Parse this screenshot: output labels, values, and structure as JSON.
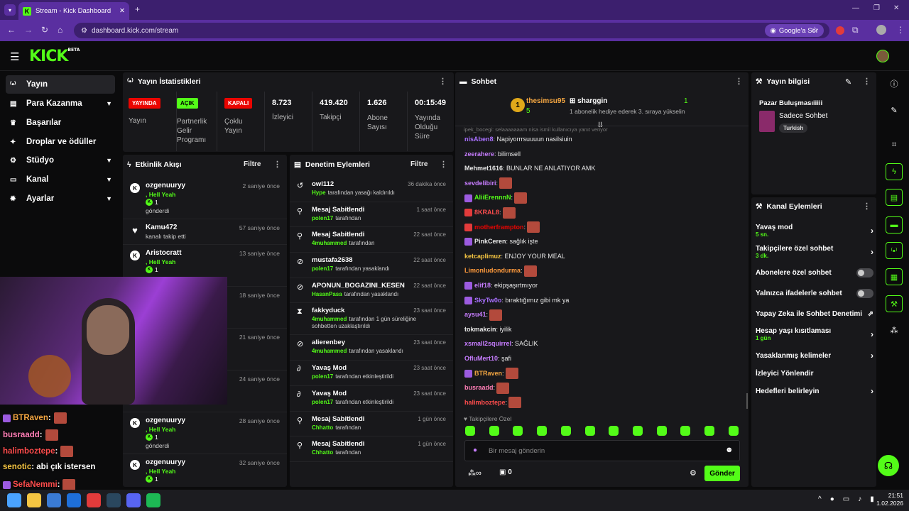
{
  "browser": {
    "tab_title": "Stream - Kick Dashboard",
    "url": "dashboard.kick.com/stream",
    "google_btn": "Google'a Sor"
  },
  "colors": {
    "accent": "#53fc18",
    "live_red": "#eb0400",
    "purple": "#5a2fa0"
  },
  "nav": [
    {
      "icon": "stream-icon",
      "label": "Yayın"
    },
    {
      "icon": "money-icon",
      "label": "Para Kazanma"
    },
    {
      "icon": "trophy-icon",
      "label": "Başarılar"
    },
    {
      "icon": "gift-icon",
      "label": "Droplar ve ödüller"
    },
    {
      "icon": "studio-icon",
      "label": "Stüdyo"
    },
    {
      "icon": "channel-icon",
      "label": "Kanal"
    },
    {
      "icon": "gear-icon",
      "label": "Ayarlar"
    }
  ],
  "stats": {
    "title": "Yayın İstatistikleri",
    "live_badge": "YAYINDA",
    "live_label": "Yayın",
    "partner_badge": "AÇIK",
    "partner_label": "Partnerlik Gelir Programı",
    "multi_badge": "KAPALI",
    "multi_label": "Çoklu Yayın",
    "viewers": "8.723",
    "viewers_label": "İzleyici",
    "followers": "419.420",
    "followers_label": "Takipçi",
    "subs": "1.626",
    "subs_label": "Abone Sayısı",
    "uptime": "00:15:49",
    "uptime_label": "Yayında Olduğu Süre"
  },
  "activity": {
    "title": "Etkinlik Akışı",
    "filter": "Filtre",
    "items": [
      {
        "name": "ozgenuuryy",
        "sub": ", Hell Yeah",
        "count": "1",
        "extra": "gönderdi",
        "time": "2 saniye önce"
      },
      {
        "name": "Kamu472",
        "sub": "",
        "count": "",
        "extra": "kanalı takip etti",
        "time": "57 saniye önce"
      },
      {
        "name": "Aristocratt",
        "sub": ", Hell Yeah",
        "count": "1",
        "extra": "",
        "time": "13 saniye önce"
      },
      {
        "name": "",
        "sub": "",
        "count": "",
        "extra": "",
        "time": "18 saniye önce"
      },
      {
        "name": "",
        "sub": "",
        "count": "",
        "extra": "",
        "time": "21 saniye önce"
      },
      {
        "name": "",
        "sub": "",
        "count": "",
        "extra": "gönderdi",
        "time": "24 saniye önce"
      },
      {
        "name": "ozgenuuryy",
        "sub": ", Hell Yeah",
        "count": "1",
        "extra": "gönderdi",
        "time": "28 saniye önce"
      },
      {
        "name": "ozgenuuryy",
        "sub": ", Hell Yeah",
        "count": "1",
        "extra": "",
        "time": "32 saniye önce"
      }
    ]
  },
  "moderation": {
    "title": "Denetim Eylemleri",
    "filter": "Filtre",
    "items": [
      {
        "icon": "undo-icon",
        "name": "owl112",
        "who": "Hype",
        "rest": "tarafından yasağı kaldırıldı",
        "time": "36 dakika önce"
      },
      {
        "icon": "pin-icon",
        "name": "Mesaj Sabitlendi",
        "who": "polen17",
        "rest": "tarafından",
        "time": "1 saat önce"
      },
      {
        "icon": "pin-icon",
        "name": "Mesaj Sabitlendi",
        "who": "4muhammed",
        "rest": "tarafından",
        "time": "22 saat önce"
      },
      {
        "icon": "ban-icon",
        "name": "mustafa2638",
        "who": "polen17",
        "rest": "tarafından yasaklandı",
        "time": "22 saat önce"
      },
      {
        "icon": "ban-icon",
        "name": "APONUN_BOGAZINI_KESEN",
        "who": "HasanPasa",
        "rest": "tarafından yasaklandı",
        "time": "22 saat önce"
      },
      {
        "icon": "hourglass-icon",
        "name": "fakkyduck",
        "who": "4muhammed",
        "rest": "tarafından 1 gün süreliğine sohbetten uzaklaştırıldı",
        "time": "23 saat önce"
      },
      {
        "icon": "ban-icon",
        "name": "alierenbey",
        "who": "4muhammed",
        "rest": "tarafından yasaklandı",
        "time": "23 saat önce"
      },
      {
        "icon": "snail-icon",
        "name": "Yavaş Mod",
        "who": "polen17",
        "rest": "tarafından etkinleştirildi",
        "time": "23 saat önce"
      },
      {
        "icon": "snail-icon",
        "name": "Yavaş Mod",
        "who": "polen17",
        "rest": "tarafından etkinleştirildi",
        "time": "23 saat önce"
      },
      {
        "icon": "pin-icon",
        "name": "Mesaj Sabitlendi",
        "who": "Chhatto",
        "rest": "tarafından",
        "time": "1 gün önce"
      },
      {
        "icon": "pin-icon",
        "name": "Mesaj Sabitlendi",
        "who": "Chhatto",
        "rest": "tarafından",
        "time": "1 gün önce"
      }
    ]
  },
  "chat": {
    "title": "Sohbet",
    "top_gifter": "thesimsu95",
    "top_count": "5",
    "pinned_user": "sharggin",
    "pinned_count": "1",
    "pinned_text": "1 abonelik hediye ederek 3. sıraya yükselin",
    "rank": "1",
    "faded": "ipek_bocegi: selaaaaaaam nisa ismil kullanıcıya yanıt veriyor",
    "messages": [
      {
        "user": "nisAben8",
        "color": "#a970ff",
        "text": ": Napiyorrrsuuuun nasilsiuin",
        "emote": false
      },
      {
        "user": "zeerahere",
        "color": "#c77dff",
        "text": ": bilimsell",
        "emote": false
      },
      {
        "user": "Mehmet1616",
        "color": "#e8e8e8",
        "text": ": BUNLAR NE ANLATIYOR AMK",
        "emote": false
      },
      {
        "user": "sevdelibiri",
        "color": "#c77dff",
        "text": ":",
        "emote": true
      },
      {
        "user": "AliiErennnN",
        "color": "#53fc18",
        "text": ":",
        "emote": true
      },
      {
        "user": "8KRAL8",
        "color": "#ff4d4d",
        "text": ":",
        "emote": true
      },
      {
        "user": "motherframpton",
        "color": "#eb0400",
        "text": ":",
        "emote": true
      },
      {
        "user": "PinkCeren",
        "color": "#e8e8e8",
        "text": ": sağlık işte",
        "emote": false
      },
      {
        "user": "ketcaplimuz",
        "color": "#f5c542",
        "text": ": ENJOY YOUR MEAL",
        "emote": false
      },
      {
        "user": "Limonludondurma",
        "color": "#ff9a3c",
        "text": ":",
        "emote": true
      },
      {
        "user": "elif18",
        "color": "#c77dff",
        "text": ": ekipşaşırtmıyor",
        "emote": false
      },
      {
        "user": "SkyTw0o",
        "color": "#a970ff",
        "text": ": bıraktığımız gibi mk ya",
        "emote": false
      },
      {
        "user": "aysu41",
        "color": "#c77dff",
        "text": ":",
        "emote": true
      },
      {
        "user": "tokmakcin",
        "color": "#e8e8e8",
        "text": ": iyilik",
        "emote": false
      },
      {
        "user": "xsmall2squirrel",
        "color": "#c77dff",
        "text": ": SAĞLIK",
        "emote": false
      },
      {
        "user": "OfluMert10",
        "color": "#c77dff",
        "text": ": şafi",
        "emote": false
      },
      {
        "user": "BTRaven",
        "color": "#f5a742",
        "text": ":",
        "emote": true
      },
      {
        "user": "busraadd",
        "color": "#ff7eb6",
        "text": ":",
        "emote": true
      },
      {
        "user": "halimboztepe",
        "color": "#ff4d4d",
        "text": ":",
        "emote": true
      }
    ],
    "followers_only": "Takipçilere Özel",
    "input_placeholder": "Bir mesaj gönderin",
    "points": "0",
    "send": "Gönder"
  },
  "streaminfo": {
    "title": "Yayın bilgisi",
    "stream_title": "Pazar Buluşmasıiiiii",
    "category": "Sadece Sohbet",
    "tag": "Turkish"
  },
  "channel": {
    "title": "Kanal Eylemleri",
    "rows": [
      {
        "label": "Yavaş mod",
        "sub": "5 sn.",
        "ctrl": "chevron"
      },
      {
        "label": "Takipçilere özel sohbet",
        "sub": "3 dk.",
        "ctrl": "chevron"
      },
      {
        "label": "Abonelere özel sohbet",
        "sub": "",
        "ctrl": "toggle"
      },
      {
        "label": "Yalnızca ifadelerle sohbet",
        "sub": "",
        "ctrl": "toggle"
      },
      {
        "label": "Yapay Zeka ile Sohbet Denetimi",
        "sub": "",
        "ctrl": "external"
      },
      {
        "label": "Hesap yaşı kısıtlaması",
        "sub": "1 gün",
        "ctrl": "chevron"
      },
      {
        "label": "Yasaklanmış kelimeler",
        "sub": "",
        "ctrl": "chevron"
      },
      {
        "label": "İzleyici Yönlendir",
        "sub": "",
        "ctrl": "none"
      },
      {
        "label": "Hedefleri belirleyin",
        "sub": "",
        "ctrl": "chevron"
      }
    ]
  },
  "overlay_chat": [
    {
      "user": "BTRaven",
      "color": "#f5a742",
      "text": ":"
    },
    {
      "user": "busraadd",
      "color": "#ff7eb6",
      "text": ":"
    },
    {
      "user": "halimboztepe",
      "color": "#ff4d4d",
      "text": ":"
    },
    {
      "user": "senotic",
      "color": "#f5c542",
      "text": ": abi çık istersen"
    },
    {
      "user": "SefaNemmi",
      "color": "#ff4d4d",
      "text": ":"
    }
  ],
  "clock": {
    "time": "21:51",
    "date": "1.02.2026"
  }
}
